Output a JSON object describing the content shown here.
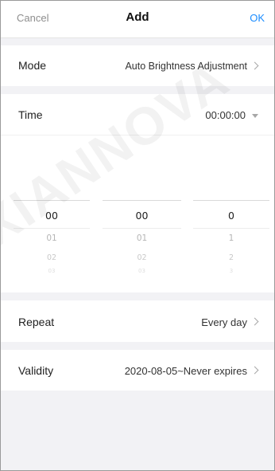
{
  "header": {
    "cancel": "Cancel",
    "title": "Add",
    "ok": "OK"
  },
  "mode": {
    "label": "Mode",
    "value": "Auto Brightness Adjustment"
  },
  "time": {
    "label": "Time",
    "value": "00:00:00",
    "picker": {
      "hours": {
        "selected": "00",
        "next1": "01",
        "next2": "02",
        "next3": "03"
      },
      "minutes": {
        "selected": "00",
        "next1": "01",
        "next2": "02",
        "next3": "03"
      },
      "seconds": {
        "selected": "0",
        "next1": "1",
        "next2": "2",
        "next3": "3"
      }
    }
  },
  "repeat": {
    "label": "Repeat",
    "value": "Every day"
  },
  "validity": {
    "label": "Validity",
    "value": "2020-08-05~Never expires"
  },
  "watermark": "XIANNOVA",
  "colors": {
    "accent": "#1a8cff",
    "background": "#f2f2f5"
  }
}
